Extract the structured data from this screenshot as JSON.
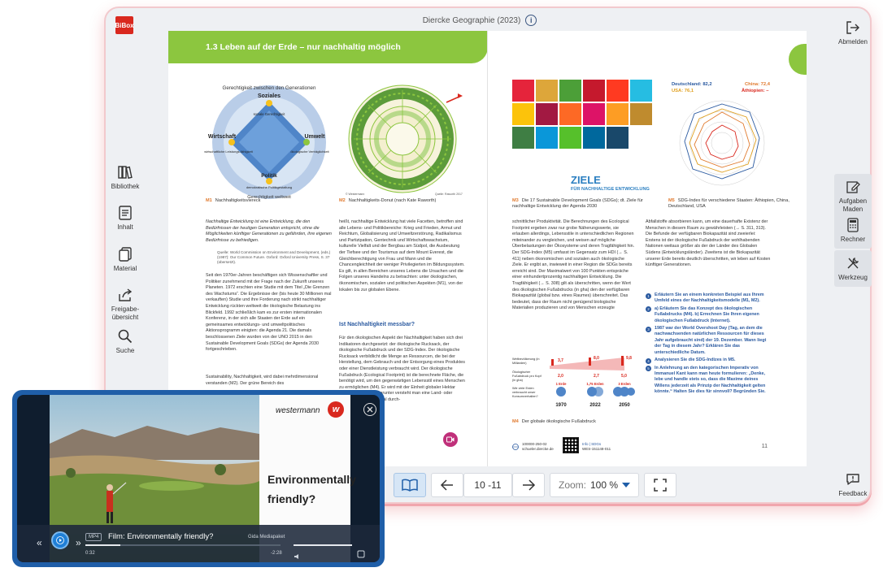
{
  "header": {
    "brand": "BiBox",
    "book_title": "Diercke Geographie (2023)",
    "info_glyph": "i"
  },
  "left_sidebar": [
    {
      "label": "Bibliothek",
      "icon": "books-icon"
    },
    {
      "label": "Inhalt",
      "icon": "contents-icon"
    },
    {
      "label": "Material",
      "icon": "material-icon"
    },
    {
      "label": "Freigabe-\nübersicht",
      "icon": "share-icon"
    },
    {
      "label": "Suche",
      "icon": "search-icon"
    }
  ],
  "right_sidebar": {
    "logout": "Abmelden",
    "tasks": "Aufgaben\nMaden",
    "calculator": "Rechner",
    "tools": "Werkzeug",
    "feedback": "Feedback"
  },
  "page_left": {
    "chapter": "1.3  Leben auf der Erde – nur nachhaltig möglich",
    "m1": {
      "label": "M1",
      "caption": "Nachhaltigkeitsviereck",
      "ring": "Gerechtigkeit zwischen den Generationen",
      "ring_bottom": "Gerechtigkeit weltweit",
      "soziales": "Soziales",
      "soziales_sub": "soziale Gerechtigkeit",
      "wirtschaft": "Wirtschaft",
      "wirtschaft_sub": "wirtschaftliche Leistungs-fähigkeit",
      "umwelt": "Umwelt",
      "umwelt_sub": "ökologische Verträglichkeit",
      "politik": "Politik",
      "politik_sub": "demokratische Politikgestaltung"
    },
    "m2": {
      "label": "M2",
      "caption": "Nachhaltigkeits-Donut (nach Kate Raworth)",
      "source": "Quelle: Raworth 2017",
      "copyright": "© Westermann"
    },
    "quote": "Nachhaltige Entwicklung ist eine Entwicklung, die den Bedürfnissen der heutigen Generation entspricht, ohne die Möglichkeiten künftiger Generationen zu gefährden, ihre eigenen Bedürfnisse zu befriedigen.",
    "quote_source": "Quelle: World Commission on Environment and Development, (eds.) (1987): Our Common Future. Oxford: Oxford University Press, S. 37 (übersetzt).",
    "col1": "Seit den 1970er-Jahren beschäftigen sich Wissenschaftler und Politiker zunehmend mit der Frage nach der Zukunft unseres Planeten. 1972 erschien eine Studie mit dem Titel „Die Grenzen des Wachstums“. Die Ergebnisse der (bis heute 30 Millionen mal verkauften) Studie und ihre Forderung nach strikt nachhaltiger Entwicklung rückten weltweit die ökologische Belastung ins Blickfeld. 1992 schließlich kam es zur ersten internationalen Konferenz, in der sich alle Staaten der Erde auf ein gemeinsames entwicklungs- und umweltpolitisches Aktionsprogramm einigten: die Agenda 21. Die damals beschlossenen Ziele wurden von der UNO 2015 in den Sustainable Development Goals (SDGs) der Agenda 2030 fortgeschrieben.",
    "col1b": "Sustainability, Nachhaltigkeit, wird dabei mehrdimensional verstanden (M2). Der grüne Bereich des",
    "col2": "heißt, nachhaltige Entwicklung hat viele Facetten, betroffen sind alle Lebens- und Politikbereiche: Krieg und Frieden, Armut und Reichtum, Globalisierung und Umweltzerstörung, Radikalismus und Partizipation, Gentechnik und Wirtschaftswachstum, kulturelle Vielfalt und der Bergbau am Südpol, die Ausbeutung der Tiefsee und der Tourismus auf dem Mount Everest, die Gleichberechtigung von Frau und Mann und die Chancengleichheit der weniger Privilegierten im Bildungssystem. Es gilt, in allen Bereichen unseres Lebens die Ursachen und die Folgen unseres Handelns zu betrachten: unter ökologischen, ökonomischen, sozialen und politischen Aspekten (M1), von der lokalen bis zur globalen Ebene.",
    "col2_heading": "Ist Nachhaltigkeit messbar?",
    "col2b": "Für den ökologischen Aspekt der Nachhaltigkeit haben sich drei Indikatoren durchgesetzt: der ökologische Rucksack, der ökologische Fußabdruck und der SDG-Index. Der ökologische Rucksack verbildlicht die Menge an Ressourcen, die bei der Herstellung, dem Gebrauch und der Entsorgung eines Produktes oder einer Dienstleistung verbraucht wird. Der ökologische Fußabdruck (Ecological Footprint) ist die berechnete Fläche, die benötigt wird, um den gegenwärtigen Lebensstil eines Menschen zu ermöglichen (M4). Er wird mit der Einheit globaler Hektar (gha) ausgedrückt. Darunter versteht man eine Land- oder Wasserfläche von global durch-"
  },
  "page_right": {
    "m3": {
      "label": "M3",
      "caption": "Die 17 Sustainable Development Goals (SDGs); dt. Ziele für nachhaltige Entwicklung der Agenda 2030",
      "ziele": "ZIELE",
      "ziele_sub": "FÜR NACHHALTIGE ENTWICKLUNG"
    },
    "m5": {
      "label": "M5",
      "caption": "SDG-Index für verschiedene Staaten: Äthiopien, China, Deutschland, USA",
      "deutschland": "Deutschland: 82,2",
      "usa": "USA: 76,1",
      "china": "China: 72,4",
      "aethiopien": "Äthiopien: –"
    },
    "col3": "schnittlicher Produktivität. Die Berechnungen des Ecological Footprint ergeben zwar nur grobe Näherungswerte, sie erlauben allerdings, Lebensstile in unterschiedlichen Regionen miteinander zu vergleichen, und weisen auf mögliche Überbelastungen der Ökosysteme und deren Tragfähigkeit hin. Der SDG-Index (M5) umfasst im Gegensatz zum HDI (→ S. 411) neben ökonomischen und sozialen auch ökologische Ziele. Er ergibt an, inwieweit in einer Region die SDGs bereits erreicht sind. Der Maximalwert von 100 Punkten entspräche einer einhundertprozentig nachhaltigen Entwicklung. Die Tragfähigkeit (→ S. 308) gilt als überschritten, wenn der Wert des ökologischen Fußabdrucks (in gha) den der verfügbaren Biokapazität (global bzw. eines Raumes) überschreitet. Das bedeutet, dass der Raum nicht genügend biologische Materialien produzieren und von Menschen erzeugte",
    "col4": "Abfallstoffe absorbieren kann, um eine dauerhafte Existenz der Menschen in diesem Raum zu gewährleisten (→ S. 311, 313). Die Befunde der verfügbaren Biokapazität sind zweierlei: Erstens ist der ökologische Fußabdruck der wohlhabenden Nationen weitaus größer als der der Länder des Globalen Südens (Entwicklungsländer). Zweitens ist die Biokapazität unserer Erde bereits deutlich überschritten, wir leben auf Kosten künftiger Generationen.",
    "tasks": [
      {
        "n": "1",
        "text": "Erläutern Sie an einem konkreten Beispiel aus Ihrem Umfeld eines der Nachhaltigkeitsmodelle (M1, M2)."
      },
      {
        "n": "2",
        "text": "a) Erläutern Sie das Konzept des ökologischen Fußabdrucks (M4). b) Errechnen Sie Ihren eigenen ökologischen Fußabdruck (Internet)."
      },
      {
        "n": "3",
        "text": "1987 war der World Overshoot Day (Tag, an dem die nachwachsenden natürlichen Ressourcen für dieses Jahr aufgebraucht sind) der 19. Dezember. Wann liegt der Tag in diesem Jahr? Erklären Sie das unterschiedliche Datum."
      },
      {
        "n": "4",
        "text": "Analysieren Sie die SDG-Indizes in M5."
      },
      {
        "n": "5",
        "text": "In Anlehnung an den kategorischen Imperativ von Immanuel Kant kann man heute formulieren: „Denke, lebe und handle stets so, dass die Maxime deines Willens jederzeit als Prinzip der Nachhaltigkeit gelten könnte.“ Halten Sie dies für sinnvoll? Begründen Sie."
      }
    ],
    "m4": {
      "label": "M4",
      "caption": "Der globale ökologische Fußabdruck",
      "row1": "Weltbevölkerung (in Milliarden)",
      "row2": "Ökologischer Fußabdruck pro Kopf (in gha)",
      "row3": "Wie viele Erden verbraucht unser Konsumverhalten?",
      "pop": [
        "3,7",
        "8,0",
        "9,8"
      ],
      "foot": [
        "2,0",
        "2,7",
        "5,0"
      ],
      "earths": [
        "1 Erde",
        "1,75 Erden",
        "3 Erden"
      ],
      "years": [
        "1970",
        "2022",
        "2050"
      ]
    },
    "footer_code": "100000-250-02",
    "footer_url": "schueler.diercke.de",
    "footer_info": "Info | SDGs",
    "footer_code2": "WES-151148-011",
    "page_number": "11"
  },
  "toolbar": {
    "page_range": "10 -11",
    "zoom_label": "Zoom:",
    "zoom_value": "100 %"
  },
  "video": {
    "publisher": "westermann",
    "slide_text": "Environmentally friendly?",
    "badge": "MP4",
    "title": "Film: Environmentally friendly?",
    "source": "Gida Mediapaket",
    "time_elapsed": "0:32",
    "time_remaining": "-2:28"
  },
  "colors": {
    "accent_green": "#8cc63f",
    "brand_red": "#d9281e",
    "link_blue": "#2b5aa0",
    "video_blue": "#1f5ea8"
  }
}
